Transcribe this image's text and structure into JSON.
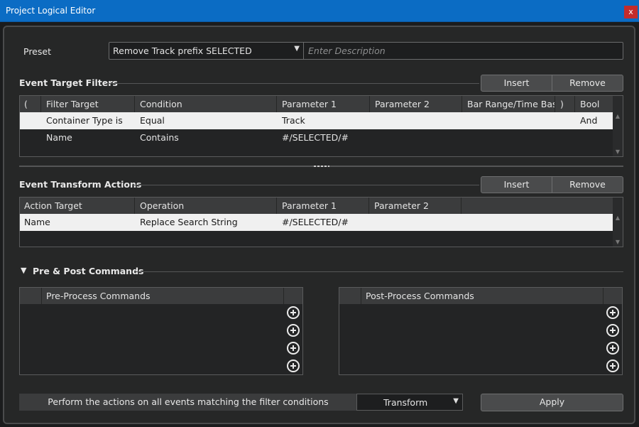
{
  "window": {
    "title": "Project Logical Editor",
    "close_label": "x"
  },
  "preset": {
    "label": "Preset",
    "value": "Remove Track prefix SELECTED",
    "description_placeholder": "Enter Description"
  },
  "filters": {
    "title": "Event Target Filters",
    "insert_label": "Insert",
    "remove_label": "Remove",
    "columns": [
      "(",
      "Filter Target",
      "Condition",
      "Parameter 1",
      "Parameter 2",
      "Bar Range/Time Base",
      ")",
      "Bool"
    ],
    "rows": [
      {
        "paren_open": "",
        "target": "Container Type is",
        "condition": "Equal",
        "param1": "Track",
        "param2": "",
        "range": "",
        "paren_close": "",
        "bool": "And"
      },
      {
        "paren_open": "",
        "target": "Name",
        "condition": "Contains",
        "param1": "#/SELECTED/#",
        "param2": "",
        "range": "",
        "paren_close": "",
        "bool": ""
      }
    ]
  },
  "actions": {
    "title": "Event Transform Actions",
    "insert_label": "Insert",
    "remove_label": "Remove",
    "columns": [
      "Action Target",
      "Operation",
      "Parameter 1",
      "Parameter 2"
    ],
    "rows": [
      {
        "target": "Name",
        "operation": "Replace Search String",
        "param1": "#/SELECTED/#",
        "param2": ""
      }
    ]
  },
  "commands": {
    "title": "Pre & Post Commands",
    "pre_header": "Pre-Process Commands",
    "post_header": "Post-Process Commands"
  },
  "footer": {
    "description": "Perform the actions on all events matching the filter conditions",
    "mode": "Transform",
    "apply_label": "Apply"
  },
  "icons": {
    "dropdown": "chevron-down-icon",
    "add": "add-circle-icon",
    "collapse": "triangle-down-icon"
  }
}
